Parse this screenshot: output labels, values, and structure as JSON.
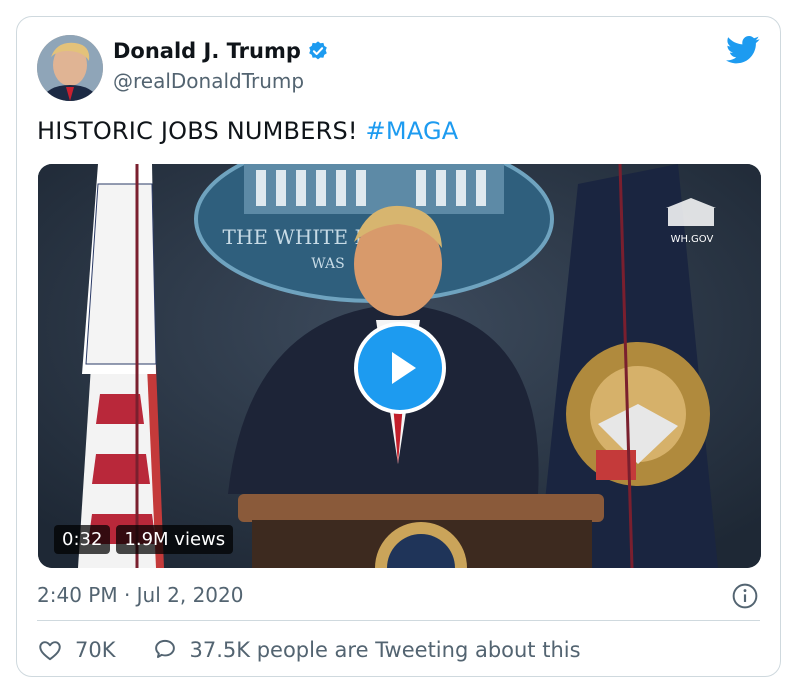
{
  "author": {
    "name": "Donald J. Trump",
    "handle": "@realDonaldTrump"
  },
  "tweet": {
    "text": "HISTORIC JOBS NUMBERS! ",
    "hashtag": "#MAGA"
  },
  "media": {
    "duration": "0:32",
    "views": "1.9M views",
    "watermark": "WH.GOV",
    "seal_text": "THE WHITE HOUSE",
    "seal_subtext": "WAS"
  },
  "meta": {
    "timestamp": "2:40 PM · Jul 2, 2020"
  },
  "actions": {
    "likes": "70K",
    "tweeting": "37.5K people are Tweeting about this"
  },
  "colors": {
    "accent": "#1d9bf0",
    "text": "#0f1419",
    "muted": "#536471",
    "border": "#cfd9de"
  }
}
